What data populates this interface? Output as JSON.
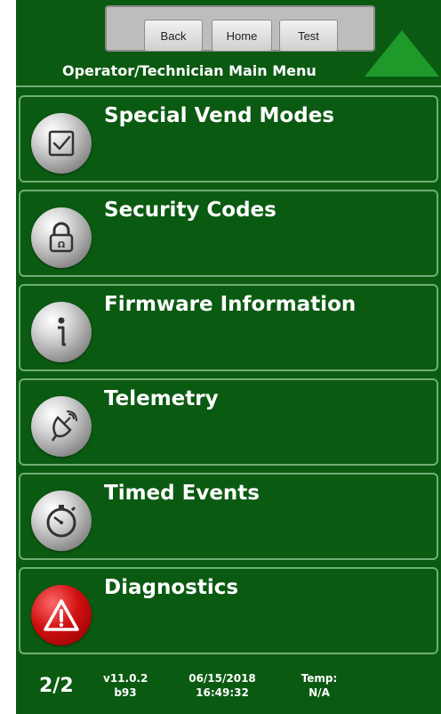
{
  "header": {
    "nav_buttons": {
      "back": "Back",
      "home": "Home",
      "test": "Test"
    },
    "title": "Operator/Technician Main Menu"
  },
  "menu_items": [
    {
      "label": "Special Vend Modes",
      "icon": "checkbox-icon"
    },
    {
      "label": "Security Codes",
      "icon": "padlock-icon"
    },
    {
      "label": "Firmware Information",
      "icon": "info-icon"
    },
    {
      "label": "Telemetry",
      "icon": "satellite-dish-icon"
    },
    {
      "label": "Timed Events",
      "icon": "stopwatch-icon"
    },
    {
      "label": "Diagnostics",
      "icon": "warning-icon"
    }
  ],
  "footer": {
    "page": "2/2",
    "version_line1": "v11.0.2",
    "version_line2": "b93",
    "date": "06/15/2018",
    "time": "16:49:32",
    "temp_label": "Temp:",
    "temp_value": "N/A"
  },
  "colors": {
    "background": "#0b5a12",
    "border": "#6fae75",
    "arrow": "#1f9a2a",
    "warning_red": "#d01010"
  }
}
